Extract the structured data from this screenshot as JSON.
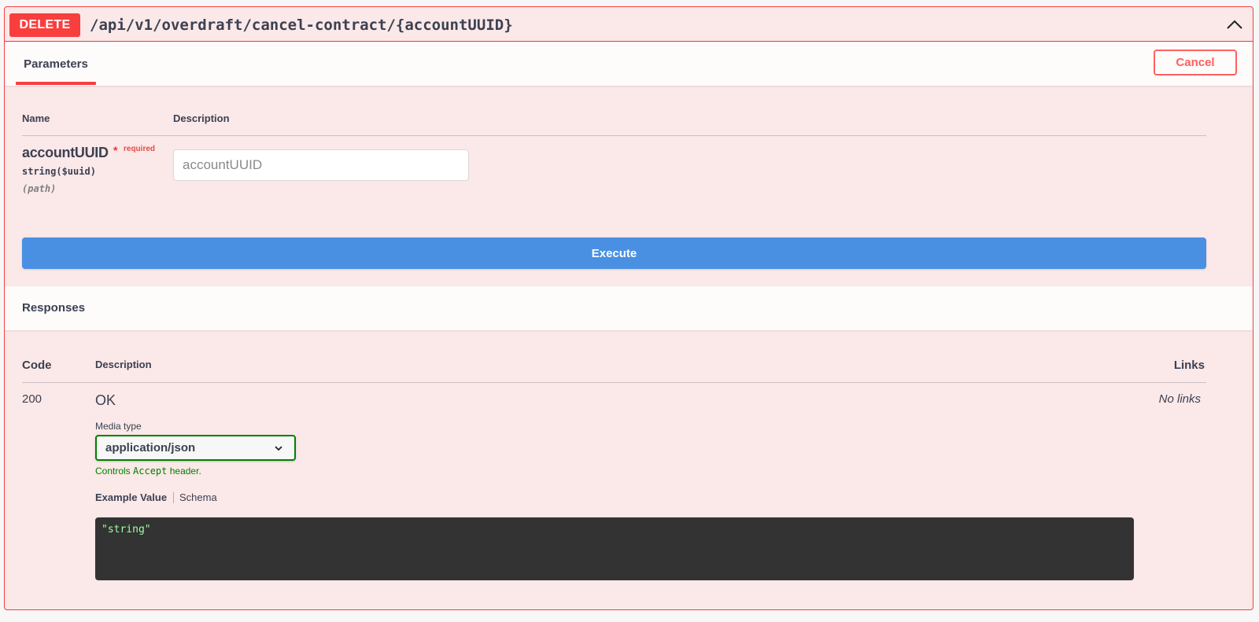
{
  "operation": {
    "method": "DELETE",
    "path": "/api/v1/overdraft/cancel-contract/{accountUUID}"
  },
  "parameters_section": {
    "tab_label": "Parameters",
    "cancel_label": "Cancel",
    "columns": {
      "name": "Name",
      "description": "Description"
    },
    "params": [
      {
        "name": "accountUUID",
        "required_star": "*",
        "required_label": "required",
        "type": "string($uuid)",
        "in": "(path)",
        "placeholder": "accountUUID"
      }
    ],
    "execute_label": "Execute"
  },
  "responses_section": {
    "title": "Responses",
    "columns": {
      "code": "Code",
      "description": "Description",
      "links": "Links"
    },
    "responses": [
      {
        "code": "200",
        "description": "OK",
        "links": "No links",
        "media_type_label": "Media type",
        "media_type": "application/json",
        "controls_prefix": "Controls",
        "controls_code": "Accept",
        "controls_suffix": "header.",
        "tab_example": "Example Value",
        "tab_schema": "Schema",
        "example_value": "\"string\""
      }
    ]
  },
  "colors": {
    "delete_accent": "#f93e3e",
    "execute_blue": "#4990e2",
    "media_green": "#008000"
  },
  "icons": {
    "collapse": "chevron-up-icon",
    "select": "chevron-down-icon"
  }
}
